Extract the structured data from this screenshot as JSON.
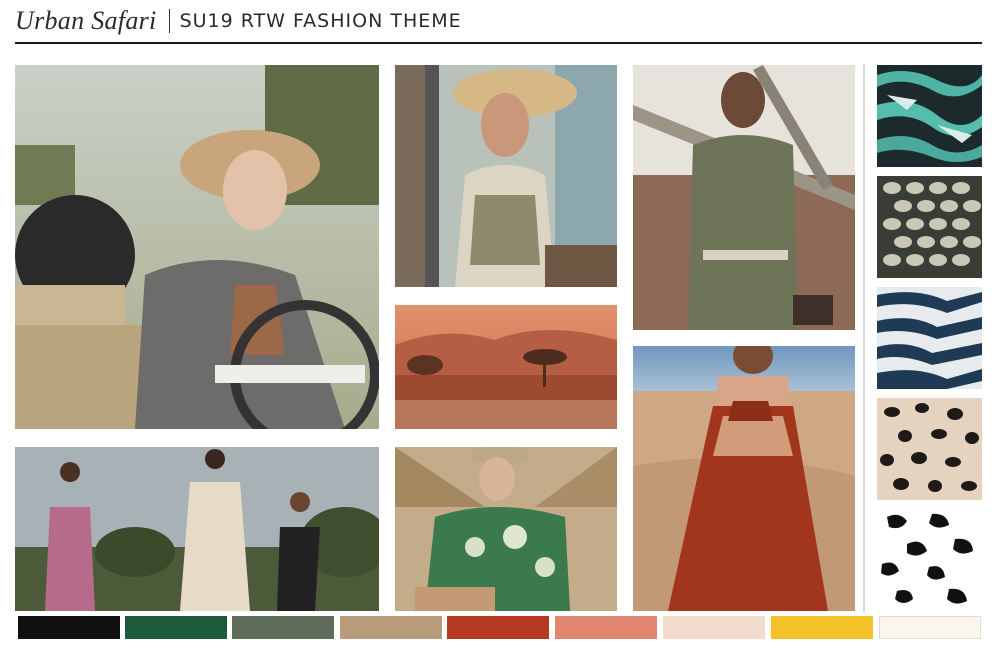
{
  "header": {
    "brand": "Urban Safari",
    "subtitle": "SU19 RTW FASHION THEME"
  },
  "images": [
    "cowboy-hat-jeep-image",
    "straw-hat-vehicle-image",
    "olive-shirt-branch-image",
    "desert-landscape-image",
    "three-models-field-image",
    "green-blouse-palm-image",
    "rust-dress-desert-image"
  ],
  "prints": [
    "teal-zebra-print",
    "python-print",
    "navy-zebra-print",
    "leopard-print",
    "black-white-spot-print"
  ],
  "palette": [
    "#111111",
    "#1e5a3c",
    "#5e6e5a",
    "#b89b78",
    "#b63a22",
    "#e08670",
    "#f2dccd",
    "#f5c128",
    "#faf6ec"
  ]
}
